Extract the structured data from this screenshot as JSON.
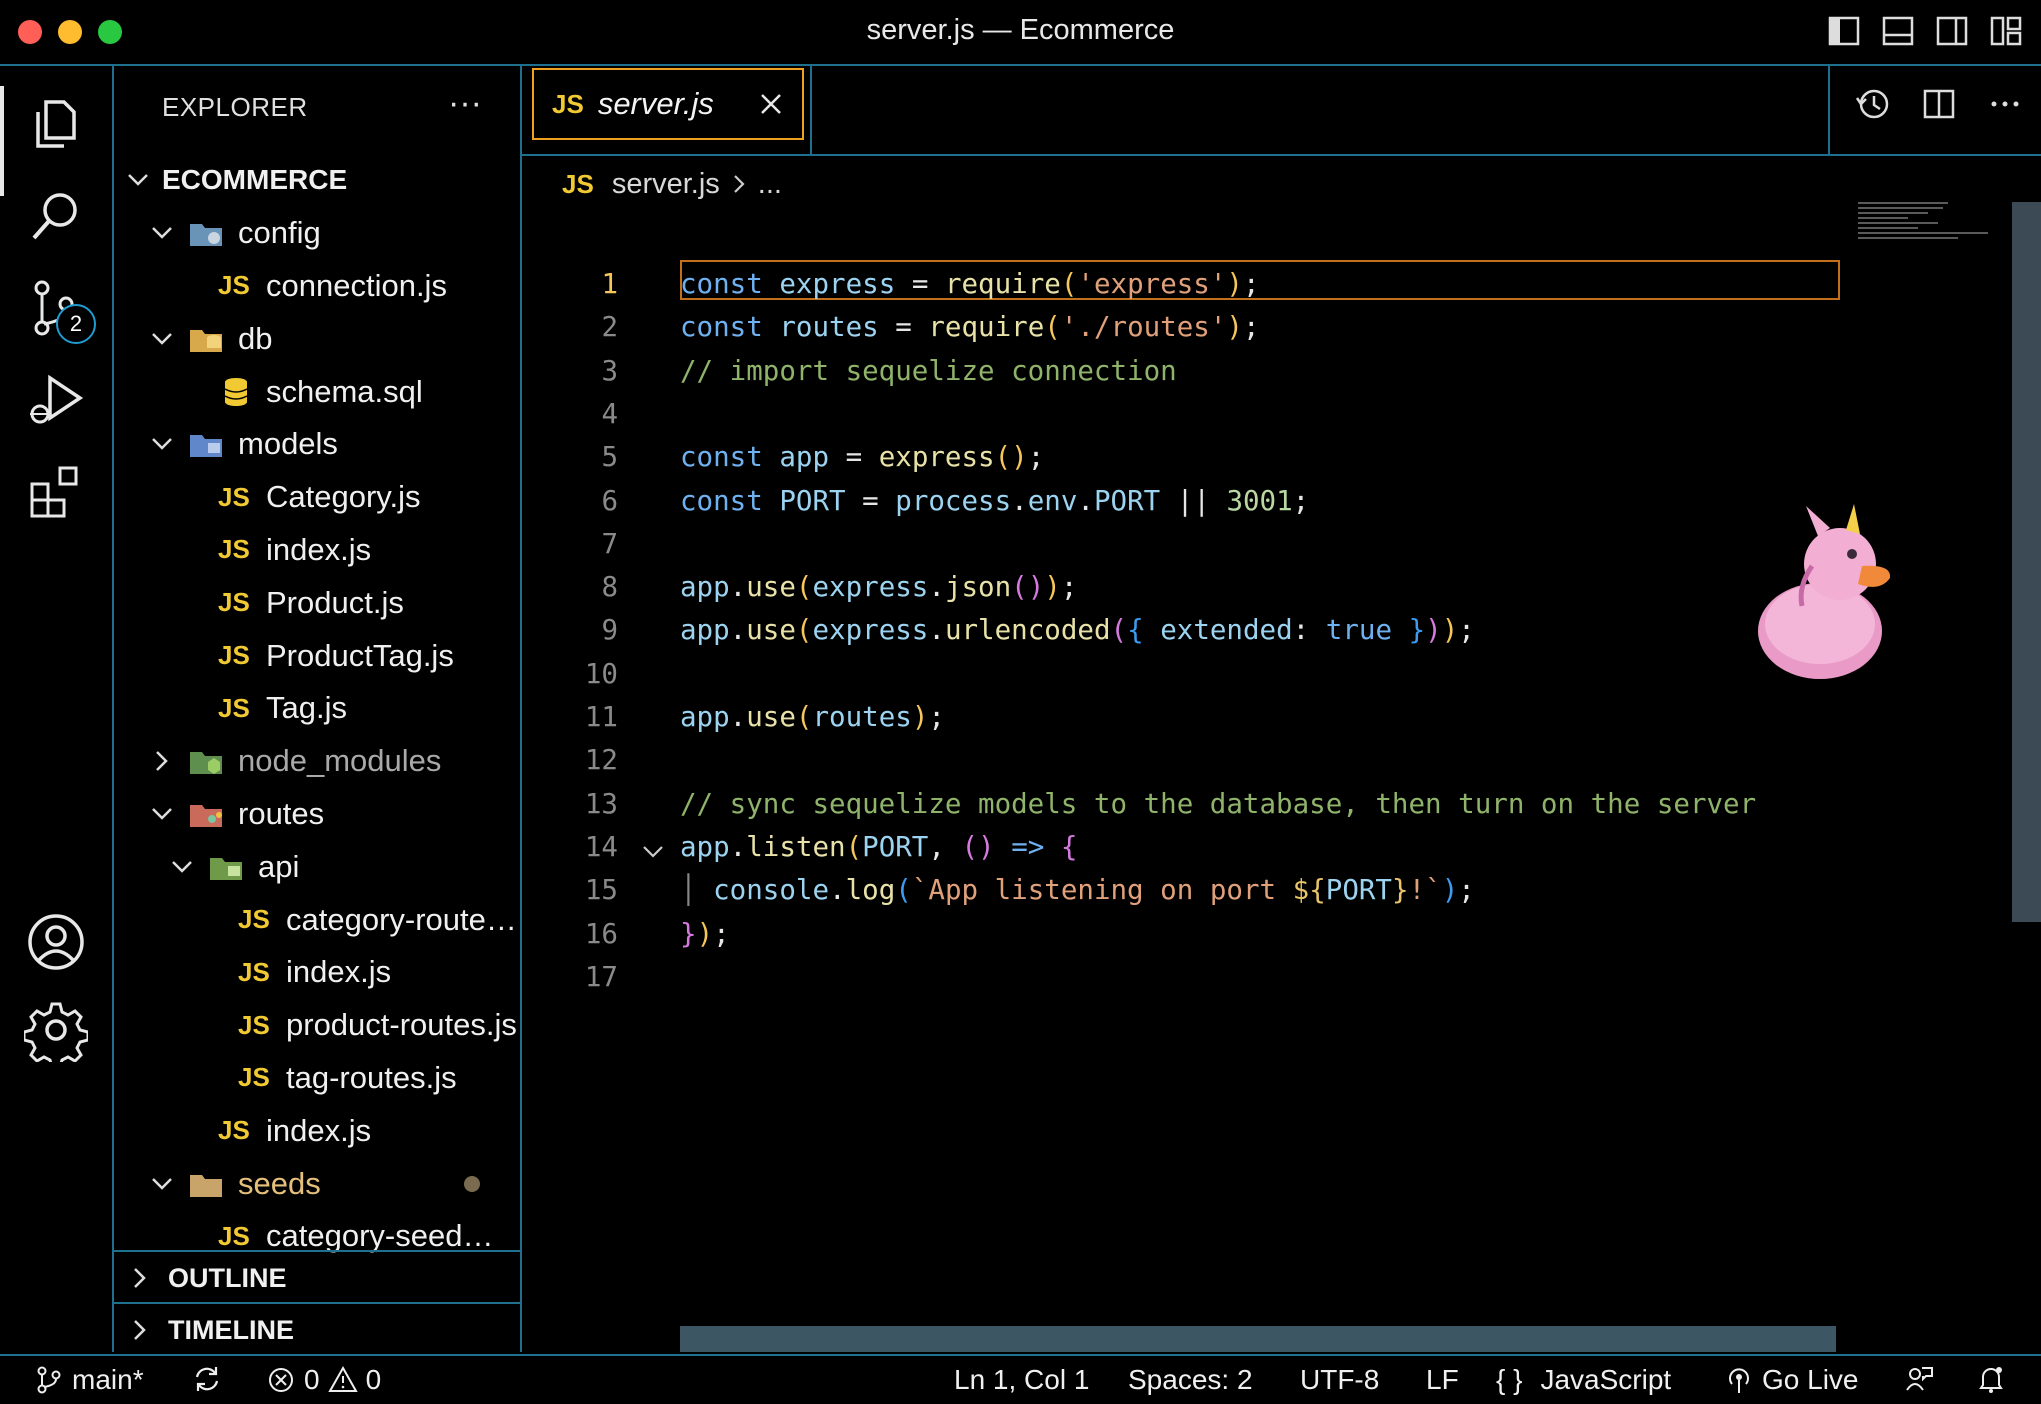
{
  "window": {
    "title": "server.js — Ecommerce"
  },
  "activity": {
    "explorer_icon": "files-icon",
    "search_icon": "search-icon",
    "source_control_icon": "source-control-icon",
    "source_control_badge": "2",
    "run_debug_icon": "run-debug-icon",
    "extensions_icon": "extensions-icon",
    "accounts_icon": "account-icon",
    "settings_icon": "gear-icon"
  },
  "explorer": {
    "header": "EXPLORER",
    "more": "···",
    "root": "ECOMMERCE",
    "items": [
      {
        "label": "config"
      },
      {
        "label": "connection.js"
      },
      {
        "label": "db"
      },
      {
        "label": "schema.sql"
      },
      {
        "label": "models"
      },
      {
        "label": "Category.js"
      },
      {
        "label": "index.js"
      },
      {
        "label": "Product.js"
      },
      {
        "label": "ProductTag.js"
      },
      {
        "label": "Tag.js"
      },
      {
        "label": "node_modules"
      },
      {
        "label": "routes"
      },
      {
        "label": "api"
      },
      {
        "label": "category-routes.js"
      },
      {
        "label": "index.js"
      },
      {
        "label": "product-routes.js"
      },
      {
        "label": "tag-routes.js"
      },
      {
        "label": "index.js"
      },
      {
        "label": "seeds"
      },
      {
        "label": "category-seeds.js"
      }
    ],
    "js_badge": "JS",
    "outline": "OUTLINE",
    "timeline": "TIMELINE"
  },
  "editor": {
    "tab_label": "server.js",
    "breadcrumb_file": "server.js",
    "breadcrumb_more": "...",
    "line_numbers": [
      "1",
      "2",
      "3",
      "4",
      "5",
      "6",
      "7",
      "8",
      "9",
      "10",
      "11",
      "12",
      "13",
      "14",
      "15",
      "16",
      "17"
    ]
  },
  "statusbar": {
    "branch": "main*",
    "errors": "0",
    "warnings": "0",
    "position": "Ln 1, Col 1",
    "spaces": "Spaces: 2",
    "encoding": "UTF-8",
    "eol": "LF",
    "language": "JavaScript",
    "language_icon": "{ }",
    "golive": "Go Live"
  },
  "colors": {
    "accent_border": "#1f6f8f",
    "tab_active_border": "#f0a020",
    "js_badge": "#f0c933"
  }
}
